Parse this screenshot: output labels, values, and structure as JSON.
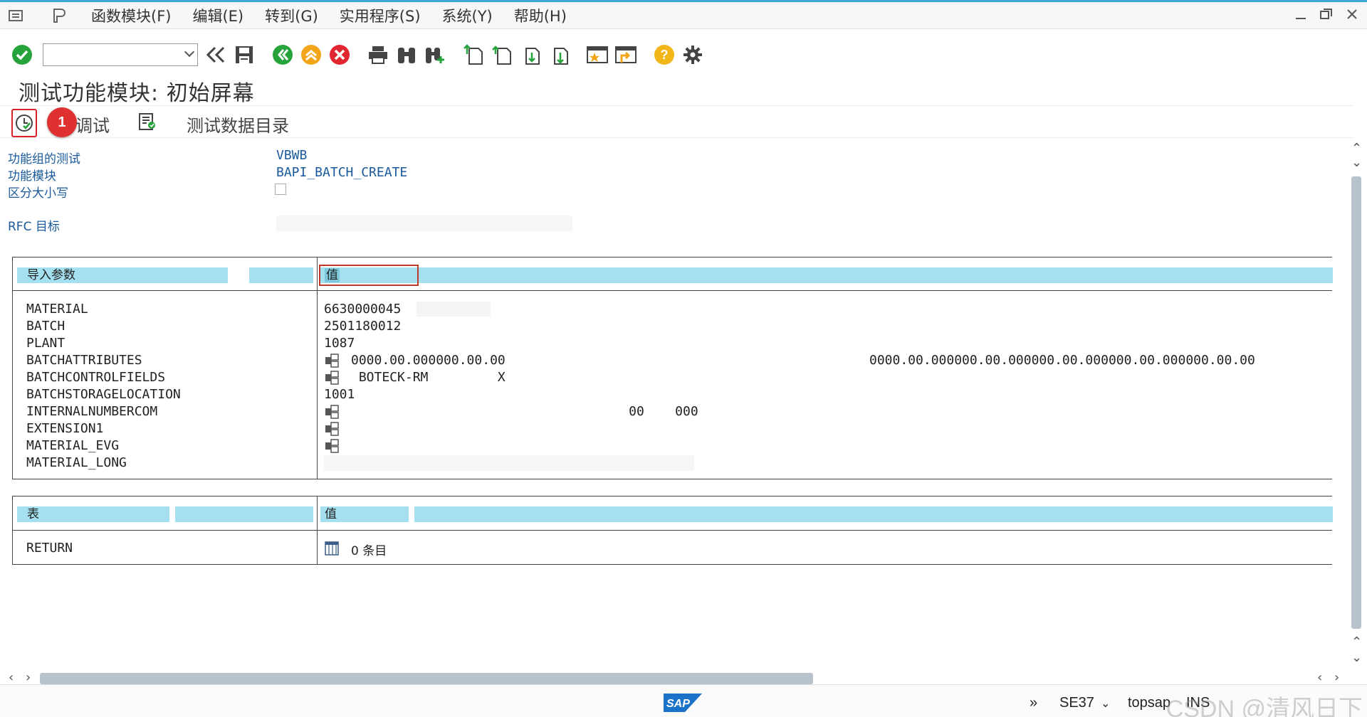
{
  "menu": {
    "items": [
      "函数模块(F)",
      "编辑(E)",
      "转到(G)",
      "实用程序(S)",
      "系统(Y)",
      "帮助(H)"
    ]
  },
  "toolbar": {
    "command_field_value": ""
  },
  "title": "测试功能模块: 初始屏幕",
  "app_toolbar": {
    "marker": "1",
    "debug_label": "调试",
    "test_data_label": "测试数据目录"
  },
  "fields": {
    "function_group_label": "功能组的测试",
    "function_group_value": "VBWB",
    "function_module_label": "功能模块",
    "function_module_value": "BAPI_BATCH_CREATE",
    "case_sensitive_label": "区分大小写",
    "case_sensitive_checked": false,
    "rfc_label": "RFC 目标",
    "rfc_value": ""
  },
  "import_params": {
    "header_name": "导入参数",
    "header_value": "值",
    "rows": [
      {
        "name": "MATERIAL",
        "value": "6630000045"
      },
      {
        "name": "BATCH",
        "value": "2501180012"
      },
      {
        "name": "PLANT",
        "value": "1087"
      },
      {
        "name": "BATCHATTRIBUTES",
        "value": "0000.00.000000.00.00",
        "value2": "0000.00.000000.00.000000.00.000000.00.000000.00.00",
        "structure": true
      },
      {
        "name": "BATCHCONTROLFIELDS",
        "value": " BOTECK-RM         X",
        "structure": true
      },
      {
        "name": "BATCHSTORAGELOCATION",
        "value": "1001"
      },
      {
        "name": "INTERNALNUMBERCOM",
        "value": "                                    00    000",
        "structure": true
      },
      {
        "name": "EXTENSION1",
        "value": "",
        "structure": true
      },
      {
        "name": "MATERIAL_EVG",
        "value": "",
        "structure": true
      },
      {
        "name": "MATERIAL_LONG",
        "value": ""
      }
    ]
  },
  "tables": {
    "header_name": "表",
    "header_value": "值",
    "rows": [
      {
        "name": "RETURN",
        "value": "0 条目"
      }
    ]
  },
  "status": {
    "transaction": "SE37",
    "server": "topsap",
    "mode": "INS",
    "watermark": "CSDN @清风日下"
  },
  "colors": {
    "header_bg": "#a4e0ef",
    "label_blue": "#1a5a9c",
    "accent": "#3fa7d6",
    "highlight_red": "#d9232a"
  }
}
